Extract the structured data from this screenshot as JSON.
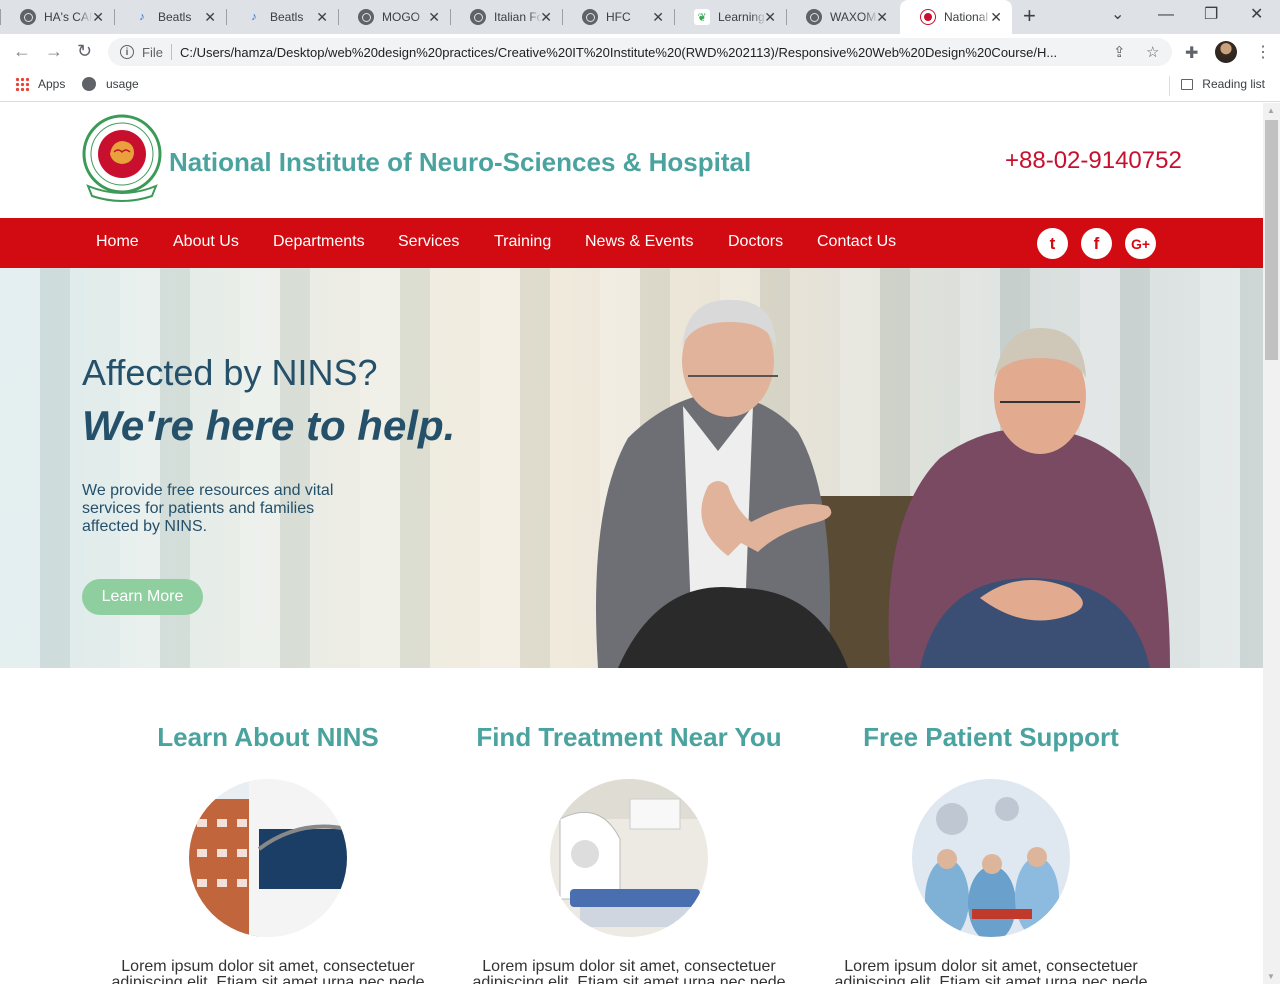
{
  "browser": {
    "tabs": [
      {
        "title": "HA's CAF",
        "icon": "globe-icon"
      },
      {
        "title": "Beatls",
        "icon": "beatls-icon"
      },
      {
        "title": "Beatls",
        "icon": "beatls-icon"
      },
      {
        "title": "MOGO",
        "icon": "globe-icon"
      },
      {
        "title": "Italian Fc",
        "icon": "globe-icon"
      },
      {
        "title": "HFC",
        "icon": "globe-icon"
      },
      {
        "title": "Learning",
        "icon": "learning-icon"
      },
      {
        "title": "WAXOM",
        "icon": "globe-icon"
      },
      {
        "title": "National",
        "icon": "nins-icon",
        "active": true
      }
    ],
    "address": {
      "scheme_label": "File",
      "url": "C:/Users/hamza/Desktop/web%20design%20practices/Creative%20IT%20Institute%20(RWD%202113)/Responsive%20Web%20Design%20Course/H..."
    },
    "bookmarks": {
      "apps_label": "Apps",
      "usage_label": "usage",
      "reading_list_label": "Reading list"
    }
  },
  "site": {
    "title": "National Institute of Neuro-Sciences & Hospital",
    "phone": "+88-02-9140752",
    "nav": [
      "Home",
      "About Us",
      "Departments",
      "Services",
      "Training",
      "News & Events",
      "Doctors",
      "Contact Us"
    ],
    "social": [
      {
        "name": "twitter-icon",
        "glyph": "t"
      },
      {
        "name": "facebook-icon",
        "glyph": "f"
      },
      {
        "name": "google-plus-icon",
        "glyph": "G+"
      }
    ]
  },
  "hero": {
    "heading": "Affected by NINS?",
    "subheading": "We're here to help.",
    "body": "We provide free resources and vital services for patients and families affected by NINS.",
    "button": "Learn More"
  },
  "features": [
    {
      "title": "Learn About NINS",
      "text": "Lorem ipsum dolor sit amet, consectetuer adipiscing elit. Etiam sit amet urna nec pede"
    },
    {
      "title": "Find Treatment Near You",
      "text": "Lorem ipsum dolor sit amet, consectetuer adipiscing elit. Etiam sit amet urna nec pede"
    },
    {
      "title": "Free Patient Support",
      "text": "Lorem ipsum dolor sit amet, consectetuer adipiscing elit. Etiam sit amet urna nec pede"
    }
  ],
  "colors": {
    "brand_red": "#d20a11",
    "brand_teal": "#4aa39e",
    "hero_text": "#25506a",
    "button_green": "#8fcf9f"
  }
}
